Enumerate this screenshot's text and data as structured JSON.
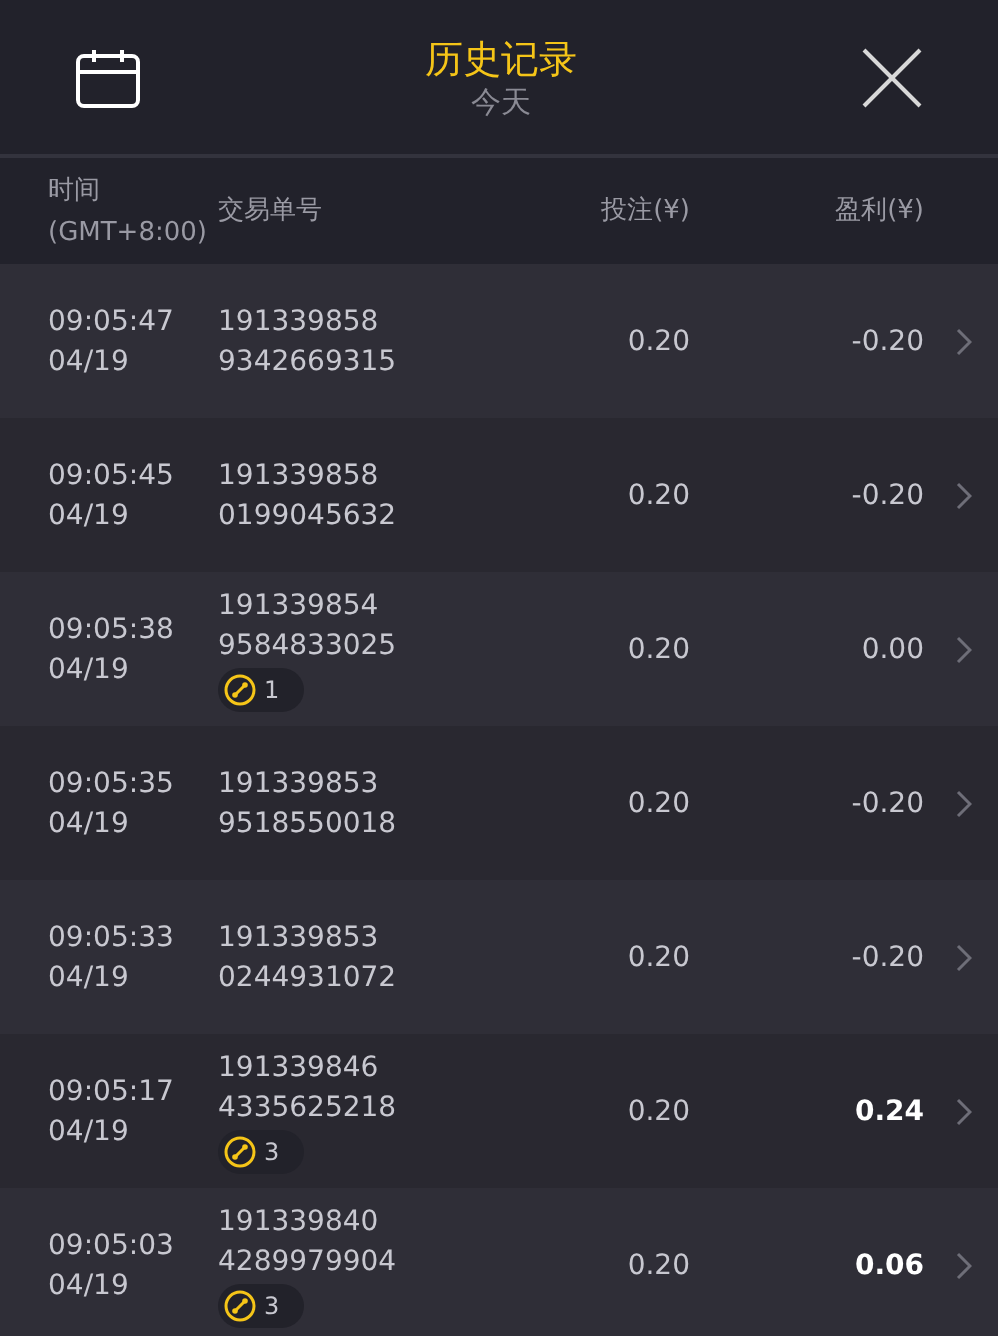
{
  "header": {
    "title": "历史记录",
    "subtitle": "今天"
  },
  "columns": [
    {
      "lines": [
        "时间",
        "(GMT+8:00)"
      ]
    },
    {
      "lines": [
        "交易单号"
      ]
    },
    {
      "lines": [
        "投注(¥)"
      ]
    },
    {
      "lines": [
        "盈利(¥)"
      ]
    }
  ],
  "rows": [
    {
      "time": "09:05:47",
      "date": "04/19",
      "order_1": "191339858",
      "order_2": "9342669315",
      "bet": "0.20",
      "profit": "-0.20",
      "emphasized": false
    },
    {
      "time": "09:05:45",
      "date": "04/19",
      "order_1": "191339858",
      "order_2": "0199045632",
      "bet": "0.20",
      "profit": "-0.20",
      "emphasized": false
    },
    {
      "time": "09:05:38",
      "date": "04/19",
      "order_1": "191339854",
      "order_2": "9584833025",
      "badge": "1",
      "bet": "0.20",
      "profit": "0.00",
      "emphasized": false
    },
    {
      "time": "09:05:35",
      "date": "04/19",
      "order_1": "191339853",
      "order_2": "9518550018",
      "bet": "0.20",
      "profit": "-0.20",
      "emphasized": false
    },
    {
      "time": "09:05:33",
      "date": "04/19",
      "order_1": "191339853",
      "order_2": "0244931072",
      "bet": "0.20",
      "profit": "-0.20",
      "emphasized": false
    },
    {
      "time": "09:05:17",
      "date": "04/19",
      "order_1": "191339846",
      "order_2": "4335625218",
      "badge": "3",
      "bet": "0.20",
      "profit": "0.24",
      "emphasized": true
    },
    {
      "time": "09:05:03",
      "date": "04/19",
      "order_1": "191339840",
      "order_2": "4289979904",
      "badge": "3",
      "bet": "0.20",
      "profit": "0.06",
      "emphasized": true
    }
  ]
}
